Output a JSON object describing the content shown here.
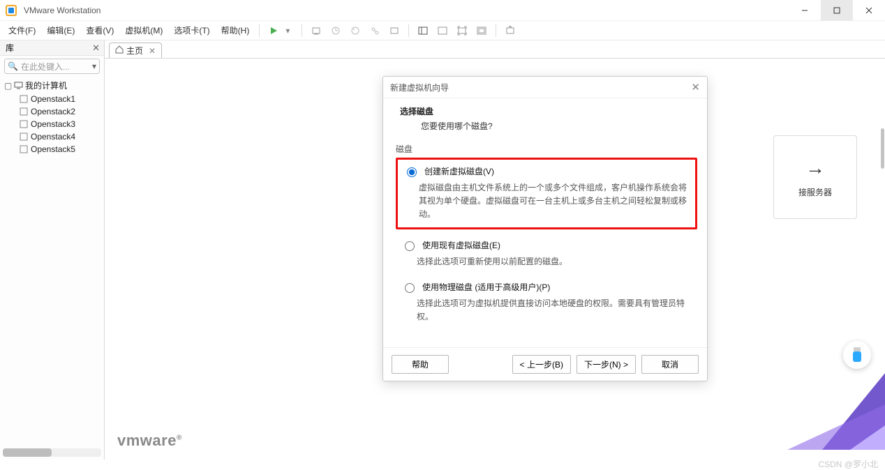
{
  "window": {
    "title": "VMware Workstation",
    "signature": "CSDN @罗小北"
  },
  "menus": {
    "file": "文件(F)",
    "edit": "编辑(E)",
    "view": "查看(V)",
    "vm": "虚拟机(M)",
    "tabs": "选项卡(T)",
    "help": "帮助(H)"
  },
  "sidebar": {
    "title": "库",
    "search_placeholder": "在此处键入...",
    "root": "我的计算机",
    "items": [
      {
        "label": "Openstack1"
      },
      {
        "label": "Openstack2"
      },
      {
        "label": "Openstack3"
      },
      {
        "label": "Openstack4"
      },
      {
        "label": "Openstack5"
      }
    ]
  },
  "tab": {
    "home": "主页"
  },
  "background_tile": {
    "label": "接服务器"
  },
  "dialog": {
    "title": "新建虚拟机向导",
    "heading": "选择磁盘",
    "subheading": "您要使用哪个磁盘?",
    "group_label": "磁盘",
    "options": [
      {
        "label": "创建新虚拟磁盘(V)",
        "desc": "虚拟磁盘由主机文件系统上的一个或多个文件组成，客户机操作系统会将其视为单个硬盘。虚拟磁盘可在一台主机上或多台主机之间轻松复制或移动。",
        "selected": true
      },
      {
        "label": "使用现有虚拟磁盘(E)",
        "desc": "选择此选项可重新使用以前配置的磁盘。",
        "selected": false
      },
      {
        "label": "使用物理磁盘 (适用于高级用户)(P)",
        "desc": "选择此选项可为虚拟机提供直接访问本地硬盘的权限。需要具有管理员特权。",
        "selected": false
      }
    ],
    "buttons": {
      "help": "帮助",
      "back": "< 上一步(B)",
      "next": "下一步(N) >",
      "cancel": "取消"
    }
  },
  "footer_logo": "vmware"
}
